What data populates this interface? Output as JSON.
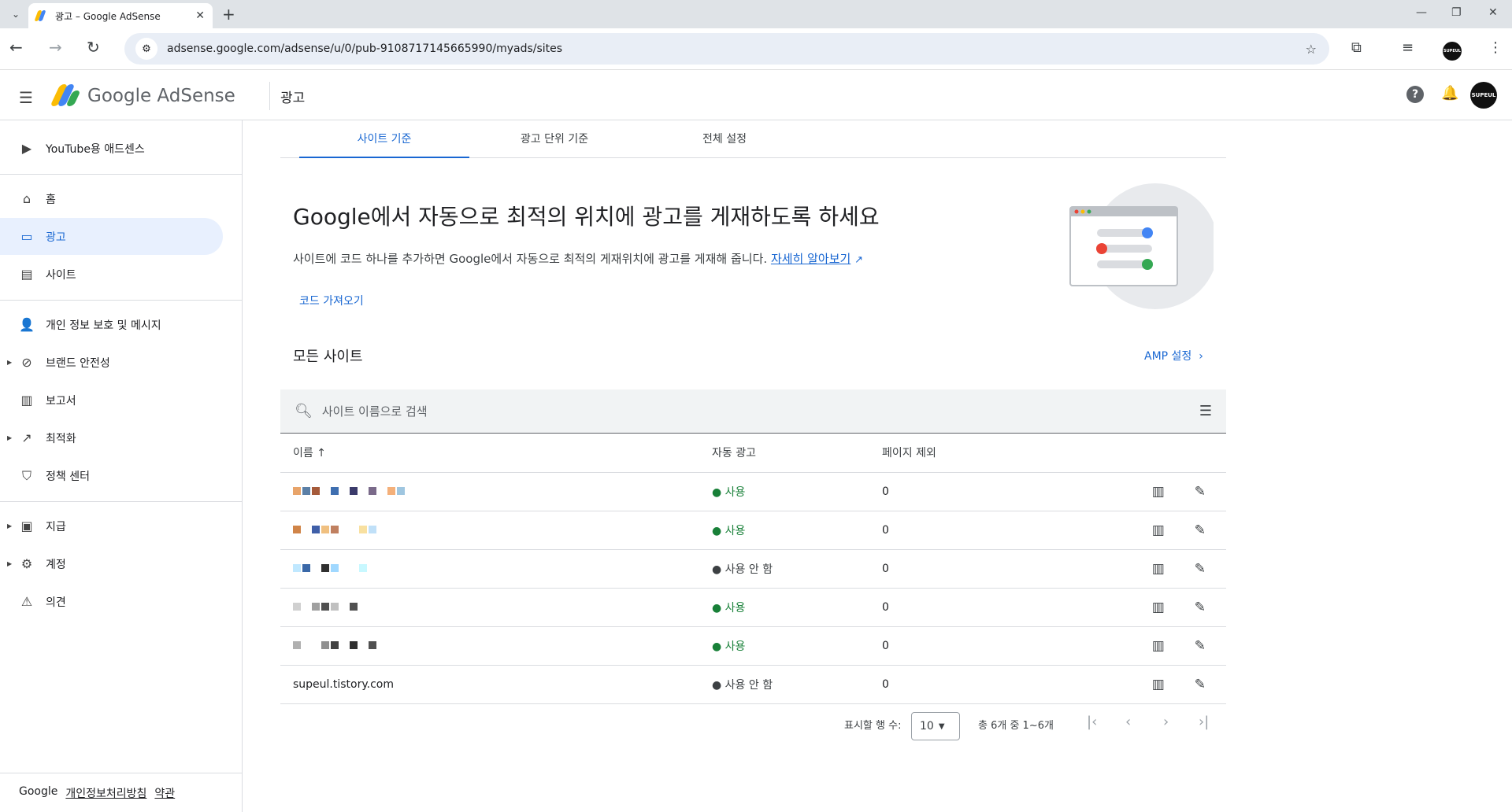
{
  "browser": {
    "tab_title": "광고 – Google AdSense",
    "tab_close": "✕",
    "new_tab": "+",
    "url": "adsense.google.com/adsense/u/0/pub-9108717145665990/myads/sites",
    "avatar_text": "SUPEUL"
  },
  "app": {
    "brand": "Google AdSense",
    "page_title": "광고",
    "help": "?",
    "avatar_text": "SUPEUL"
  },
  "sidebar": {
    "youtube": "YouTube용 애드센스",
    "home": "홈",
    "ads": "광고",
    "sites": "사이트",
    "privacy": "개인 정보 보호 및 메시지",
    "brand_safety": "브랜드 안전성",
    "reports": "보고서",
    "optimization": "최적화",
    "policy": "정책 센터",
    "payments": "지급",
    "account": "계정",
    "feedback": "의견",
    "footer": {
      "google": "Google",
      "privacy": "개인정보처리방침",
      "terms": "약관"
    }
  },
  "tabs": [
    "사이트 기준",
    "광고 단위 기준",
    "전체 설정"
  ],
  "hero": {
    "title": "Google에서 자동으로 최적의 위치에 광고를 게재하도록 하세요",
    "desc": "사이트에 코드 하나를 추가하면 Google에서 자동으로 최적의 게재위치에 광고를 게재해 줍니다.",
    "learn_more": "자세히 알아보기",
    "get_code": "코드 가져오기"
  },
  "sites_section": {
    "title": "모든 사이트",
    "amp": "AMP 설정",
    "search_placeholder": "사이트 이름으로 검색",
    "columns": {
      "name": "이름",
      "auto_ads": "자동 광고",
      "exclusions": "페이지 제외"
    },
    "rows": [
      {
        "name": "",
        "status": "● 사용",
        "on": true,
        "exclusions": "0"
      },
      {
        "name": "",
        "status": "● 사용",
        "on": true,
        "exclusions": "0"
      },
      {
        "name": "",
        "status": "● 사용 안 함",
        "on": false,
        "exclusions": "0"
      },
      {
        "name": "",
        "status": "● 사용",
        "on": true,
        "exclusions": "0"
      },
      {
        "name": "",
        "status": "● 사용",
        "on": true,
        "exclusions": "0"
      },
      {
        "name": "supeul.tistory.com",
        "status": "● 사용 안 함",
        "on": false,
        "exclusions": "0"
      }
    ]
  },
  "pagination": {
    "rows_label": "표시할 행 수:",
    "rows_value": "10",
    "count": "총 6개 중 1~6개"
  },
  "colors": {
    "primary": "#1967d2",
    "enabled": "#188038",
    "active_bg": "#e8f0fe"
  }
}
